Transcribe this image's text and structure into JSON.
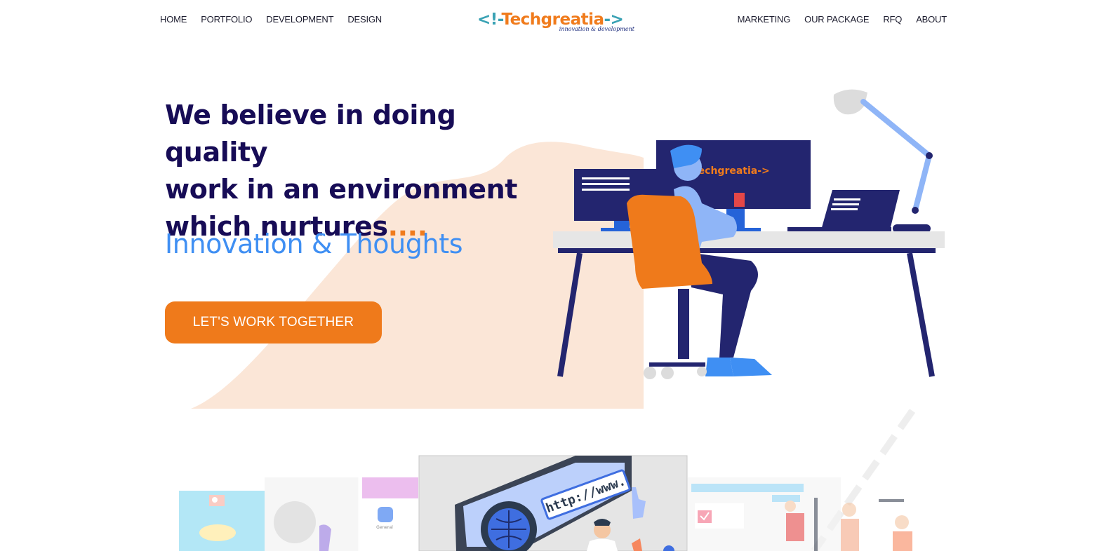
{
  "nav": {
    "left": [
      {
        "label": "HOME"
      },
      {
        "label": "PORTFOLIO"
      },
      {
        "label": "DEVELOPMENT"
      },
      {
        "label": "DESIGN"
      }
    ],
    "right": [
      {
        "label": "MARKETING"
      },
      {
        "label": "OUR PACKAGE"
      },
      {
        "label": "RFQ"
      },
      {
        "label": "ABOUT"
      }
    ]
  },
  "logo": {
    "open": "<!-",
    "word": "Techgreatia",
    "close": "->",
    "tagline": "innovation & development"
  },
  "hero": {
    "line1": "We believe in doing quality",
    "line2": "work in an environment",
    "line3": "which nurtures",
    "dots": "....",
    "subline": "Innovation & Thoughts",
    "cta_label": "LET'S WORK TOGETHER"
  },
  "illustration": {
    "screen_logo": "-Techgreatia->",
    "url_text": "http://www.",
    "app_label": "General"
  },
  "colors": {
    "navy": "#170c56",
    "orange": "#ef7a1b",
    "blue": "#3f8ff3",
    "teal": "#3aa2b4",
    "peach": "#fbe6d7"
  }
}
